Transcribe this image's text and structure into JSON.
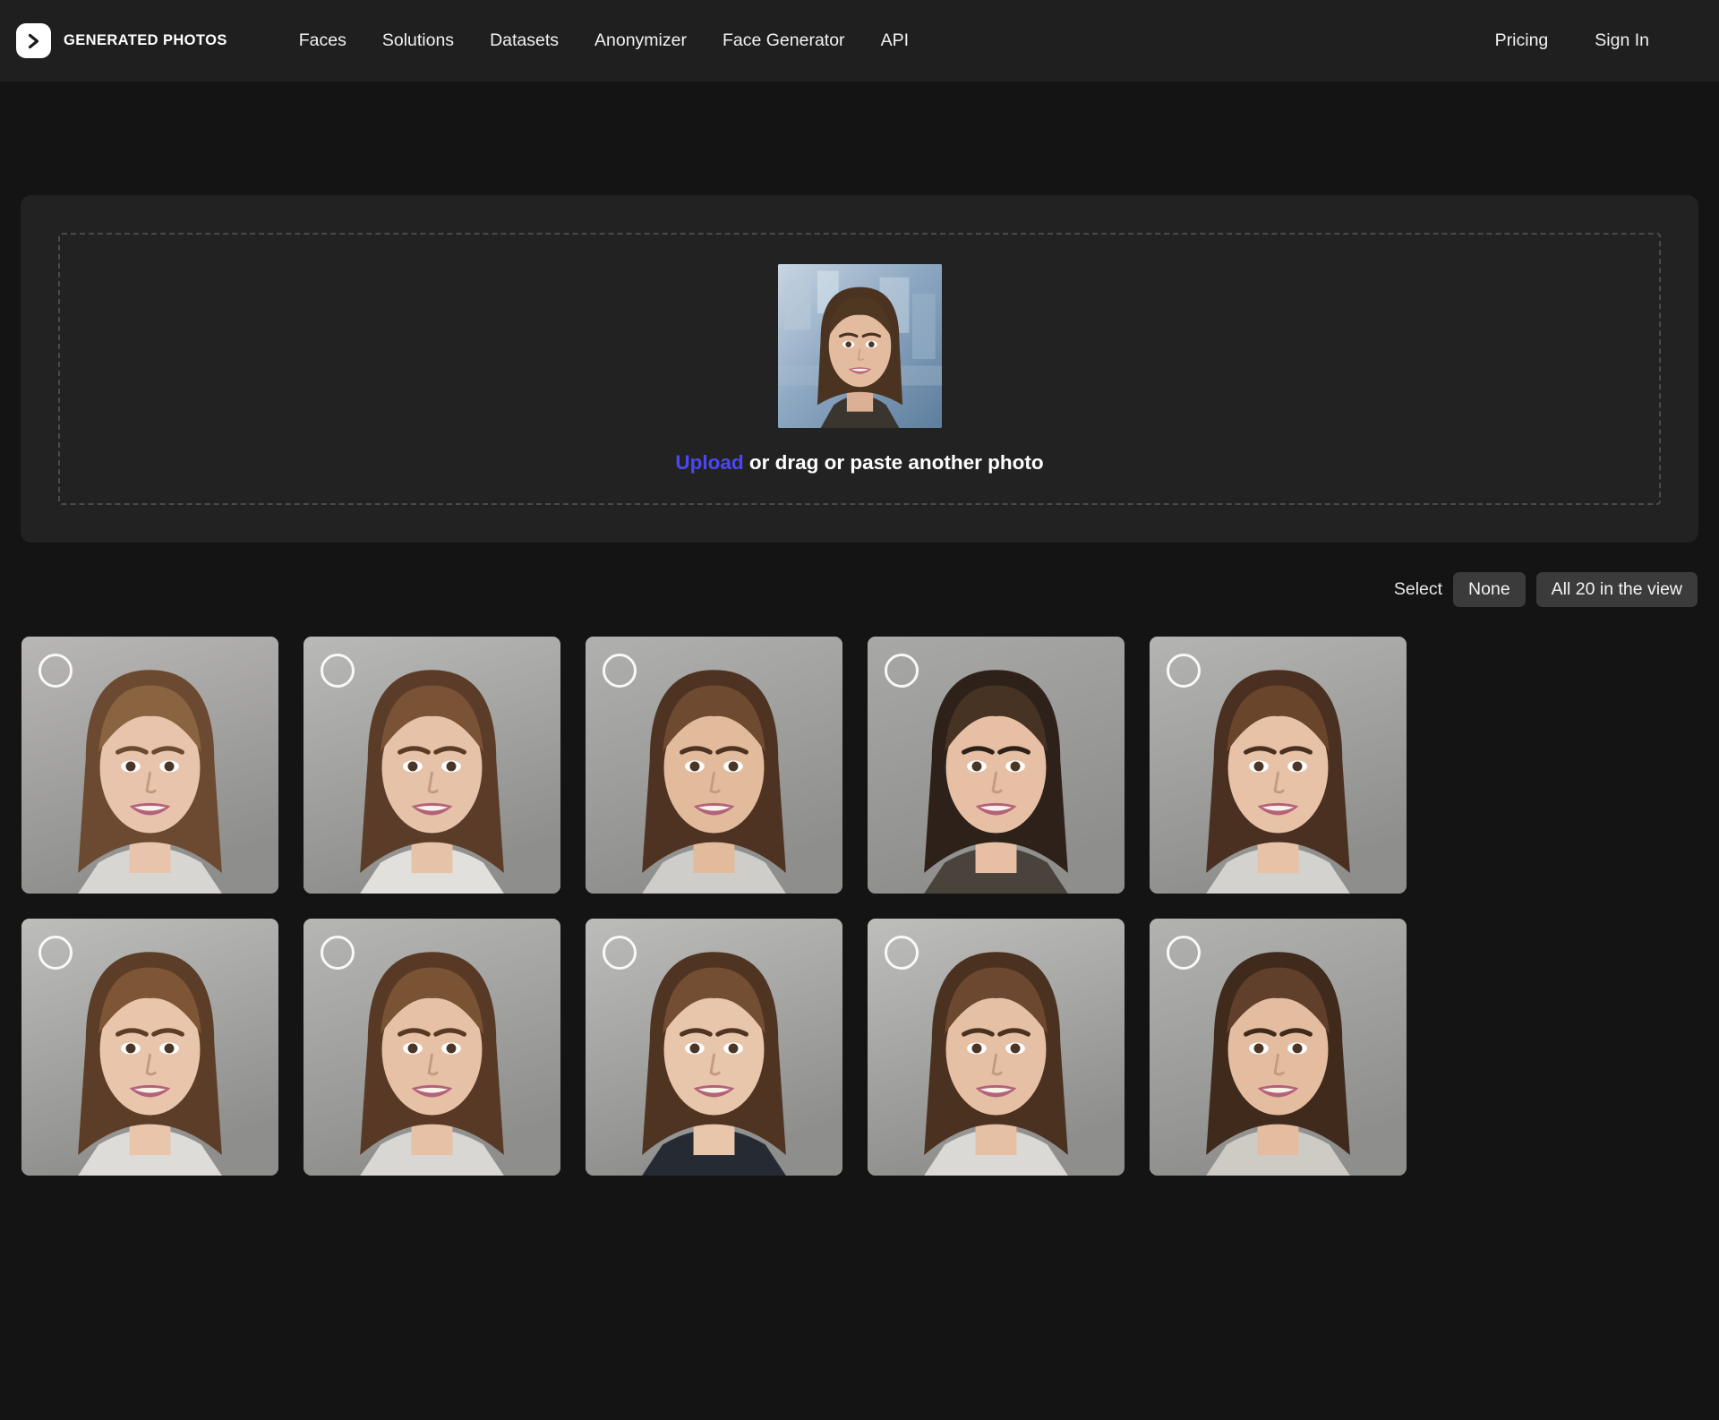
{
  "header": {
    "logo_icon": "chevron-right-logo-icon",
    "brand_name": "GENERATED PHOTOS",
    "nav": [
      {
        "label": "Faces"
      },
      {
        "label": "Solutions"
      },
      {
        "label": "Datasets"
      },
      {
        "label": "Anonymizer"
      },
      {
        "label": "Face Generator"
      },
      {
        "label": "API"
      }
    ],
    "nav_right": [
      {
        "label": "Pricing"
      },
      {
        "label": "Sign In"
      }
    ]
  },
  "upload": {
    "thumbnail_alt": "uploaded-portrait",
    "caption_link": "Upload",
    "caption_rest": " or drag or paste another photo",
    "link_color": "#4b47f5"
  },
  "select_bar": {
    "label": "Select",
    "none_label": "None",
    "all_label": "All 20 in the view"
  },
  "grid": {
    "columns": 5,
    "faces": [
      {
        "id": "face-1",
        "bg": "#b8b7b5",
        "hair": "#6b4a31",
        "hair2": "#8a6440",
        "skin": "#e8c4ac",
        "top": "#d8d6d2"
      },
      {
        "id": "face-2",
        "bg": "#b9b9b7",
        "hair": "#5a3c28",
        "hair2": "#7a5236",
        "skin": "#e6c2a9",
        "top": "#e2e0dc"
      },
      {
        "id": "face-3",
        "bg": "#b0b0ae",
        "hair": "#4e3322",
        "hair2": "#6e4a30",
        "skin": "#e2bb9d",
        "top": "#cfcdc9"
      },
      {
        "id": "face-4",
        "bg": "#a8a8a6",
        "hair": "#2e2119",
        "hair2": "#463324",
        "skin": "#e6bfa4",
        "top": "#4a433c"
      },
      {
        "id": "face-5",
        "bg": "#b4b4b2",
        "hair": "#4a3021",
        "hair2": "#69452c",
        "skin": "#e7c2a6",
        "top": "#d4d2ce"
      },
      {
        "id": "face-6",
        "bg": "#bdbdbb",
        "hair": "#5c3d28",
        "hair2": "#7e5636",
        "skin": "#e9c6ab",
        "top": "#dedcd8"
      },
      {
        "id": "face-7",
        "bg": "#b6b6b4",
        "hair": "#573925",
        "hair2": "#7a5334",
        "skin": "#e6c1a5",
        "top": "#d9d7d3"
      },
      {
        "id": "face-8",
        "bg": "#bcbcba",
        "hair": "#4f3422",
        "hair2": "#744e32",
        "skin": "#e8c6ab",
        "top": "#262b33"
      },
      {
        "id": "face-9",
        "bg": "#bebebc",
        "hair": "#4b3120",
        "hair2": "#6d4830",
        "skin": "#e5c0a4",
        "top": "#dbd9d5"
      },
      {
        "id": "face-10",
        "bg": "#b2b2b0",
        "hair": "#3f2a1c",
        "hair2": "#60402a",
        "skin": "#e4bda0",
        "top": "#cecac4"
      }
    ]
  }
}
